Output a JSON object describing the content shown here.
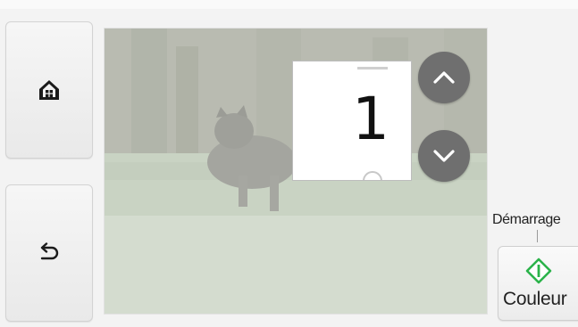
{
  "counter": {
    "value": "1"
  },
  "start": {
    "label": "Démarrage",
    "button_label": "Couleur",
    "accent": "#2bb34a"
  },
  "icons": {
    "home": "home-icon",
    "back": "back-arrow-icon",
    "up": "chevron-up-icon",
    "down": "chevron-down-icon",
    "start": "start-diamond-icon"
  },
  "colors": {
    "round_button": "#6f6f6f",
    "background": "#f3f3f3"
  }
}
